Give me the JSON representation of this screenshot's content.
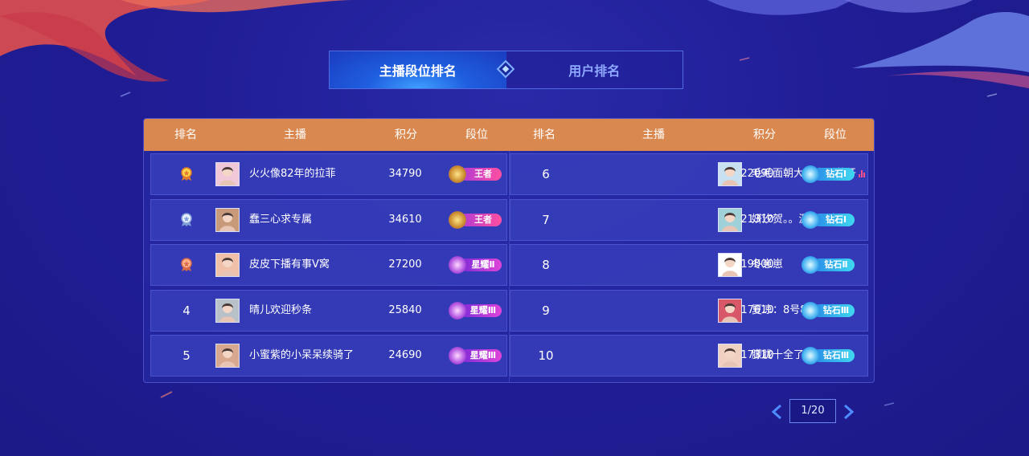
{
  "tabs": [
    {
      "label": "主播段位排名",
      "active": true
    },
    {
      "label": "用户排名",
      "active": false
    }
  ],
  "columns": {
    "rank": "排名",
    "streamer": "主播",
    "score": "积分",
    "tier": "段位"
  },
  "left_rows": [
    {
      "rank": "",
      "medal": "gold",
      "name": "火火像82年的拉菲",
      "score": "34790",
      "tier": "王者",
      "tier_type": "king"
    },
    {
      "rank": "",
      "medal": "silver",
      "name": "蠢三心求专属",
      "score": "34610",
      "tier": "王者",
      "tier_type": "king"
    },
    {
      "rank": "",
      "medal": "bronze",
      "name": "皮皮下播有事V窝",
      "score": "27200",
      "tier": "星耀Ⅱ",
      "tier_type": "star"
    },
    {
      "rank": "4",
      "medal": "",
      "name": "晴儿欢迎秒条",
      "score": "25840",
      "tier": "星耀Ⅲ",
      "tier_type": "star"
    },
    {
      "rank": "5",
      "medal": "",
      "name": "小蜜紫的小呆呆续骑了",
      "score": "24690",
      "tier": "星耀Ⅲ",
      "tier_type": "star"
    }
  ],
  "right_rows": [
    {
      "rank": "6",
      "name": "毛毛面朝大海春暖花开",
      "live": true,
      "score": "22090",
      "tier": "钻石Ⅰ",
      "tier_type": "diamond"
    },
    {
      "rank": "7",
      "name": "妍汐贺。。源少回归",
      "live": true,
      "score": "21310",
      "tier": "钻石Ⅰ",
      "tier_type": "diamond"
    },
    {
      "rank": "8",
      "name": "冬崽崽",
      "live": false,
      "score": "19000",
      "tier": "钻石Ⅱ",
      "tier_type": "diamond"
    },
    {
      "rank": "9",
      "name": "夏凉：8号8点庆生哟",
      "live": false,
      "score": "17610",
      "tier": "钻石Ⅲ",
      "tier_type": "diamond"
    },
    {
      "rank": "10",
      "name": "朦胧十全了美呢",
      "live": false,
      "score": "17310",
      "tier": "钻石Ⅲ",
      "tier_type": "diamond"
    }
  ],
  "pager": {
    "text": "1/20",
    "prev_icon": "chevron-left-icon",
    "next_icon": "chevron-right-icon"
  },
  "colors": {
    "header": "#d9884f",
    "background": "#201d96",
    "accent": "#3fa0ff"
  }
}
